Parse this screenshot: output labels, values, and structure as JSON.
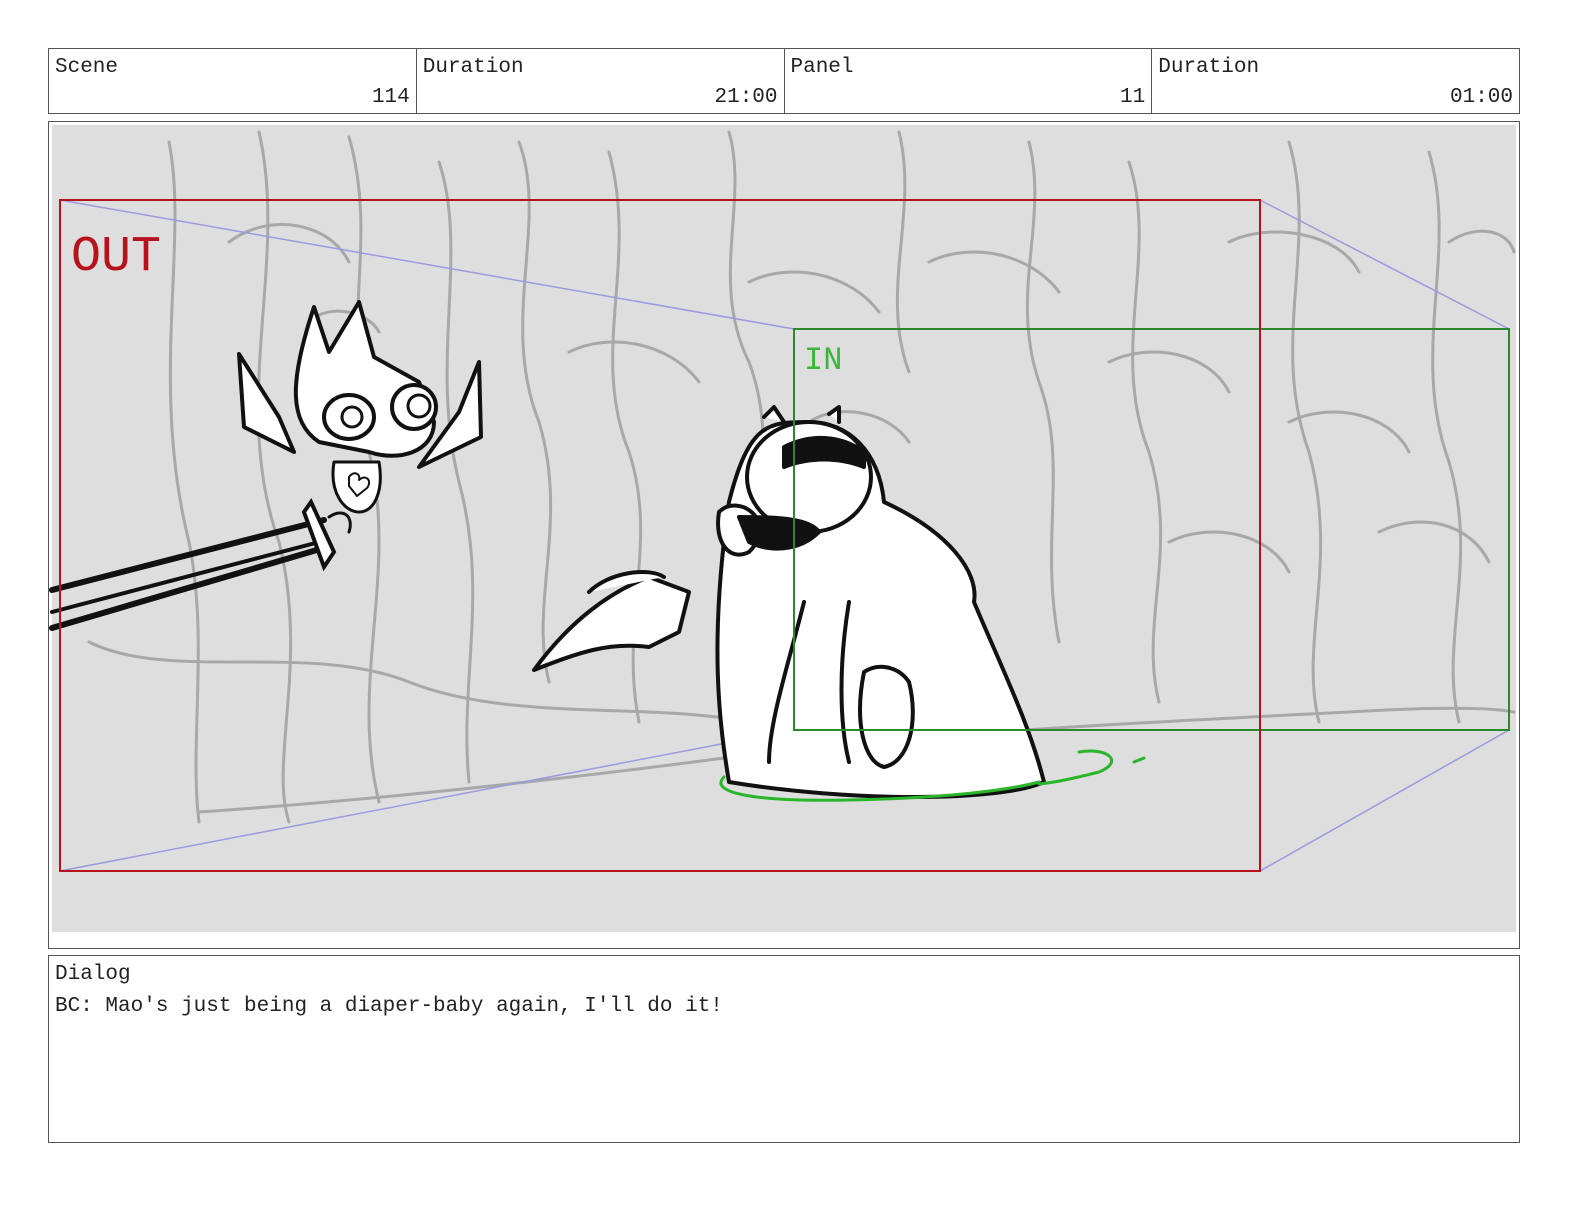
{
  "header": {
    "scene_label": "Scene",
    "scene_value": "114",
    "scene_duration_label": "Duration",
    "scene_duration_value": "21:00",
    "panel_label": "Panel",
    "panel_value": "11",
    "panel_duration_label": "Duration",
    "panel_duration_value": "01:00"
  },
  "frames": {
    "out_label": "OUT",
    "in_label": "IN",
    "out_color": "#b5121b",
    "in_color": "#2a8a2a",
    "guide_color": "#9a9ae0"
  },
  "dialog": {
    "label": "Dialog",
    "text": "BC: Mao's just being a diaper-baby again, I'll do it!"
  }
}
